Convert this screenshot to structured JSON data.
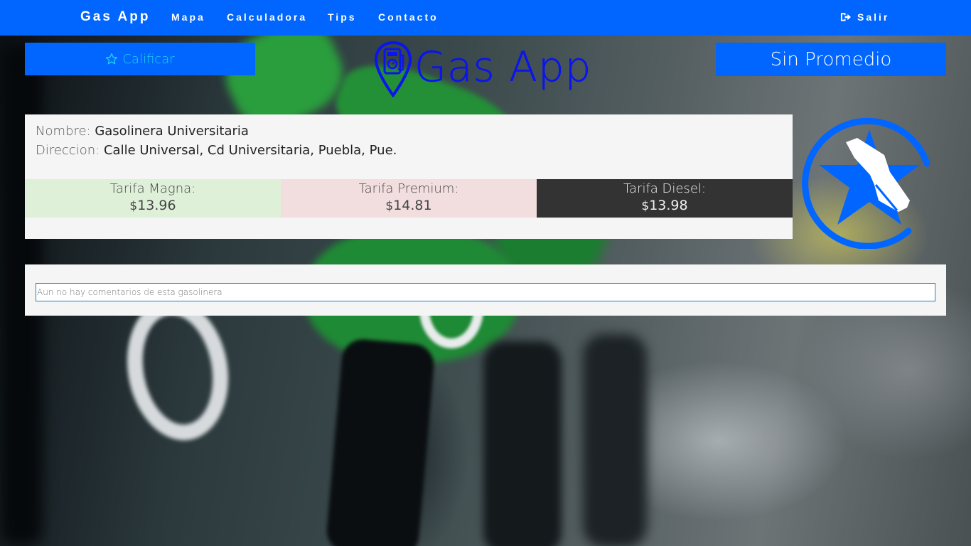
{
  "navbar": {
    "brand": "Gas App",
    "links": [
      "Mapa",
      "Calculadora",
      "Tips",
      "Contacto"
    ],
    "logout_label": "Salir",
    "logout_icon": "sign-out-icon",
    "color": "#0066ff"
  },
  "rate_button": {
    "label": "Calificar",
    "icon": "star-outline-icon"
  },
  "logo": {
    "title": "Gas App",
    "icon": "gas-pin-icon",
    "color": "#0a14ee"
  },
  "average": {
    "label": "Sin Promedio"
  },
  "station": {
    "name_label": "Nombre:",
    "name": "Gasolinera Universitaria",
    "address_label": "Direccion:",
    "address": "Calle Universal, Cd Universitaria, Puebla, Pue.",
    "logo_icon": "star-fuel-nozzle-icon"
  },
  "tariffs": [
    {
      "label": "Tarifa Magna:",
      "currency": "$",
      "price": "13.96",
      "color": "#dff0d8"
    },
    {
      "label": "Tarifa Premium:",
      "currency": "$",
      "price": "14.81",
      "color": "#f2dede"
    },
    {
      "label": "Tarifa Diesel:",
      "currency": "$",
      "price": "13.98",
      "color": "#333333"
    }
  ],
  "comments": {
    "placeholder": "Aun no hay comentarios de esta gasolinera"
  }
}
